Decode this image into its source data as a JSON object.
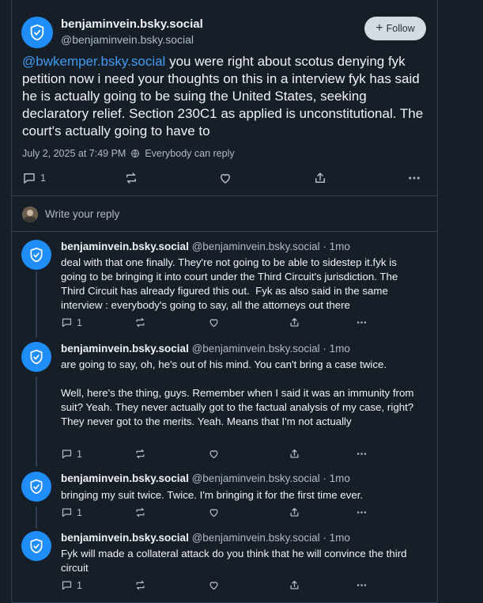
{
  "main_post": {
    "display_name": "benjaminvein.bsky.social",
    "handle": "@benjaminvein.bsky.social",
    "follow_label": "Follow",
    "mention": "@bwkemper.bsky.social",
    "text": " you were right about scotus denying fyk petition now i need your thoughts on this in a interview fyk has said he is actually going to be suing the United States, seeking declaratory relief. Section 230C1 as applied is unconstitutional. The court's actually going to have to",
    "timestamp": "July 2, 2025 at 7:49 PM",
    "visibility": "Everybody can reply",
    "reply_count": "1"
  },
  "reply_box": {
    "placeholder": "Write your reply"
  },
  "replies": [
    {
      "display_name": "benjaminvein.bsky.social",
      "handle": "@benjaminvein.bsky.social · 1mo",
      "text": "deal with that one finally. They're not going to be able to sidestep it.fyk is going to be bringing it into court under the Third Circuit's jurisdiction. The Third Circuit has already figured this out.  Fyk as also said in the same interview : everybody's going to say, all the attorneys out there",
      "reply_count": "1"
    },
    {
      "display_name": "benjaminvein.bsky.social",
      "handle": "@benjaminvein.bsky.social · 1mo",
      "text": "are going to say, oh, he's out of his mind. You can't bring a case twice.\n\nWell, here's the thing, guys. Remember when I said it was an immunity from suit? Yeah. They never actually got to the factual analysis of my case, right? They never got to the merits. Yeah. Means that I'm not actually",
      "reply_count": "1"
    },
    {
      "display_name": "benjaminvein.bsky.social",
      "handle": "@benjaminvein.bsky.social · 1mo",
      "text": "bringing my suit twice. Twice. I'm bringing it for the first time ever.",
      "reply_count": "1"
    },
    {
      "display_name": "benjaminvein.bsky.social",
      "handle": "@benjaminvein.bsky.social · 1mo",
      "text": "Fyk will made a collateral attack do you think that he will convince the third circuit",
      "reply_count": "1"
    }
  ],
  "colors": {
    "accent": "#1f8dfa",
    "link": "#3e9cf5",
    "background": "#161e27",
    "muted": "#aebbc9"
  }
}
